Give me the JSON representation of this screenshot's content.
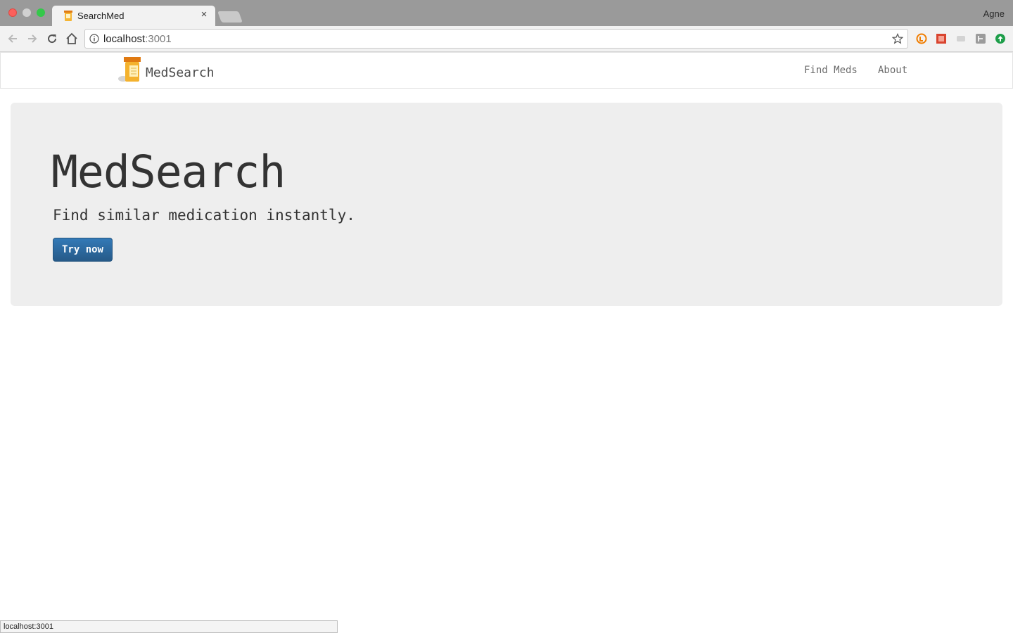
{
  "browser": {
    "tab_title": "SearchMed",
    "profile_name": "Agne",
    "url_host": "localhost",
    "url_port": ":3001",
    "status_url": "localhost:3001"
  },
  "navbar": {
    "brand": "MedSearch",
    "links": [
      "Find Meds",
      "About"
    ]
  },
  "hero": {
    "title": "MedSearch",
    "subtitle": "Find similar medication instantly.",
    "button": "Try now"
  },
  "colors": {
    "primary_button": "#286090",
    "jumbotron_bg": "#eeeeee"
  },
  "icons": [
    "pill-bottle-icon",
    "close-icon",
    "back-arrow-icon",
    "forward-arrow-icon",
    "reload-icon",
    "home-icon",
    "info-icon",
    "star-icon"
  ]
}
